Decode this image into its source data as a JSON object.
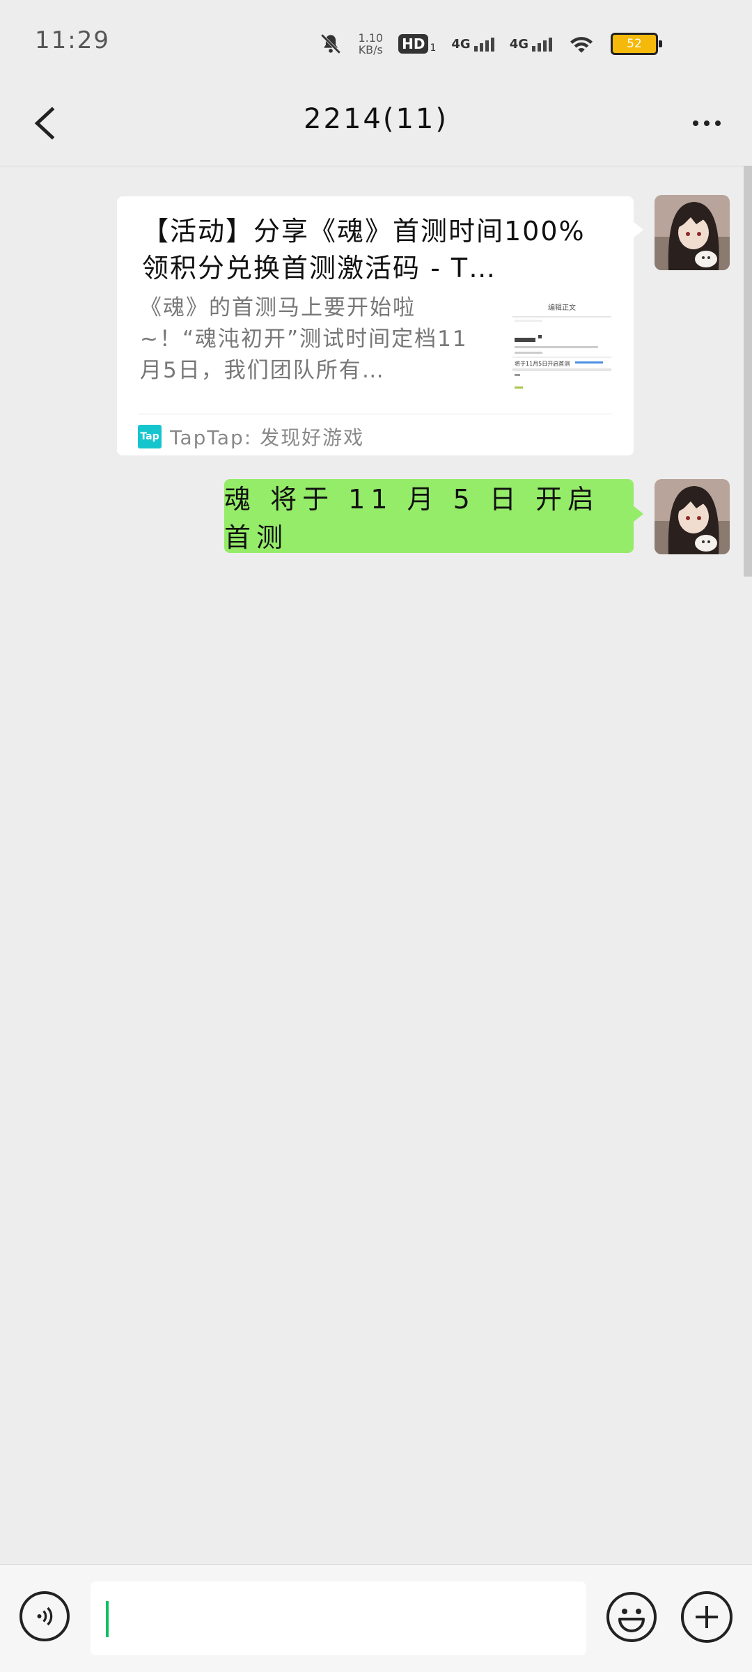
{
  "status_bar": {
    "time": "11:29",
    "net_speed_value": "1.10",
    "net_speed_unit": "KB/s",
    "hd_label": "HD",
    "hd_sub": "1",
    "signal1_label": "4G",
    "signal2_label": "4G",
    "battery": "52"
  },
  "header": {
    "title": "2214(11)"
  },
  "messages": {
    "link_card": {
      "title": "【活动】分享《魂》首测时间100%领积分兑换首测激活码 - T…",
      "description": "《魂》的首测马上要开始啦~！“魂沌初开”测试时间定档11月5日，我们团队所有…",
      "source_logo": "Tap",
      "source": "TapTap: 发现好游戏",
      "thumb_heading": "编辑正文",
      "thumb_line": "将于11月5日开启首测"
    },
    "text_message": "魂 将于 11 月 5 日 开启 首测"
  },
  "input_bar": {
    "placeholder": ""
  },
  "colors": {
    "background": "#ededed",
    "my_bubble": "#95ec69",
    "accent": "#07c160",
    "tap_brand": "#15c5ce"
  },
  "icons": {
    "back": "chevron-left-icon",
    "more": "ellipsis-icon",
    "voice": "voice-icon",
    "emoji": "emoji-icon",
    "plus": "plus-icon"
  }
}
